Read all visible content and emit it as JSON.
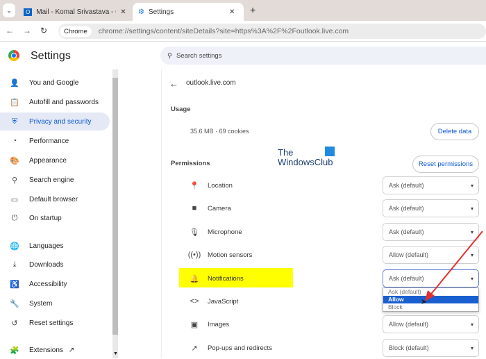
{
  "tabs": [
    {
      "label": "Mail - Komal Srivastava - Outlo",
      "icon": "outlook-icon"
    },
    {
      "label": "Settings",
      "icon": "gear-icon"
    }
  ],
  "url": "chrome://settings/content/siteDetails?site=https%3A%2F%2Foutlook.live.com",
  "chip": "Chrome",
  "header": {
    "title": "Settings",
    "search_placeholder": "Search settings"
  },
  "sidebar": [
    {
      "label": "You and Google",
      "icon": "person-icon",
      "glyph": "👤"
    },
    {
      "label": "Autofill and passwords",
      "icon": "clipboard-icon",
      "glyph": "📋"
    },
    {
      "label": "Privacy and security",
      "icon": "shield-icon",
      "glyph": "⛨",
      "active": true
    },
    {
      "label": "Performance",
      "icon": "speedometer-icon",
      "glyph": "◔"
    },
    {
      "label": "Appearance",
      "icon": "palette-icon",
      "glyph": "🎨"
    },
    {
      "label": "Search engine",
      "icon": "search-icon",
      "glyph": "⚲"
    },
    {
      "label": "Default browser",
      "icon": "browser-icon",
      "glyph": "▭"
    },
    {
      "label": "On startup",
      "icon": "power-icon",
      "glyph": "⏻"
    },
    {
      "label": "Languages",
      "icon": "globe-icon",
      "glyph": "🌐"
    },
    {
      "label": "Downloads",
      "icon": "download-icon",
      "glyph": "⤓"
    },
    {
      "label": "Accessibility",
      "icon": "accessibility-icon",
      "glyph": "♿"
    },
    {
      "label": "System",
      "icon": "wrench-icon",
      "glyph": "🔧"
    },
    {
      "label": "Reset settings",
      "icon": "reset-icon",
      "glyph": "↺"
    },
    {
      "label": "Extensions",
      "icon": "puzzle-icon",
      "glyph": "🧩"
    }
  ],
  "site": "outlook.live.com",
  "usage": {
    "heading": "Usage",
    "value": "35.6 MB · 69 cookies",
    "delete": "Delete data"
  },
  "permissions": {
    "heading": "Permissions",
    "reset": "Reset permissions",
    "rows": [
      {
        "label": "Location",
        "icon": "location-icon",
        "glyph": "📍",
        "value": "Ask (default)"
      },
      {
        "label": "Camera",
        "icon": "camera-icon",
        "glyph": "■",
        "value": "Ask (default)"
      },
      {
        "label": "Microphone",
        "icon": "microphone-icon",
        "glyph": "🎙",
        "value": "Ask (default)"
      },
      {
        "label": "Motion sensors",
        "icon": "sensor-icon",
        "glyph": "((•))",
        "value": "Allow (default)"
      },
      {
        "label": "Notifications",
        "icon": "bell-icon",
        "glyph": "🔔",
        "value": "Ask (default)"
      },
      {
        "label": "JavaScript",
        "icon": "code-icon",
        "glyph": "<>",
        "value": ""
      },
      {
        "label": "Images",
        "icon": "image-icon",
        "glyph": "▣",
        "value": "Allow (default)"
      },
      {
        "label": "Pop-ups and redirects",
        "icon": "popup-icon",
        "glyph": "↗",
        "value": "Block (default)"
      }
    ]
  },
  "dropdown_options": [
    "Ask (default)",
    "Allow",
    "Block"
  ],
  "watermark": [
    "The",
    "WindowsClub"
  ]
}
